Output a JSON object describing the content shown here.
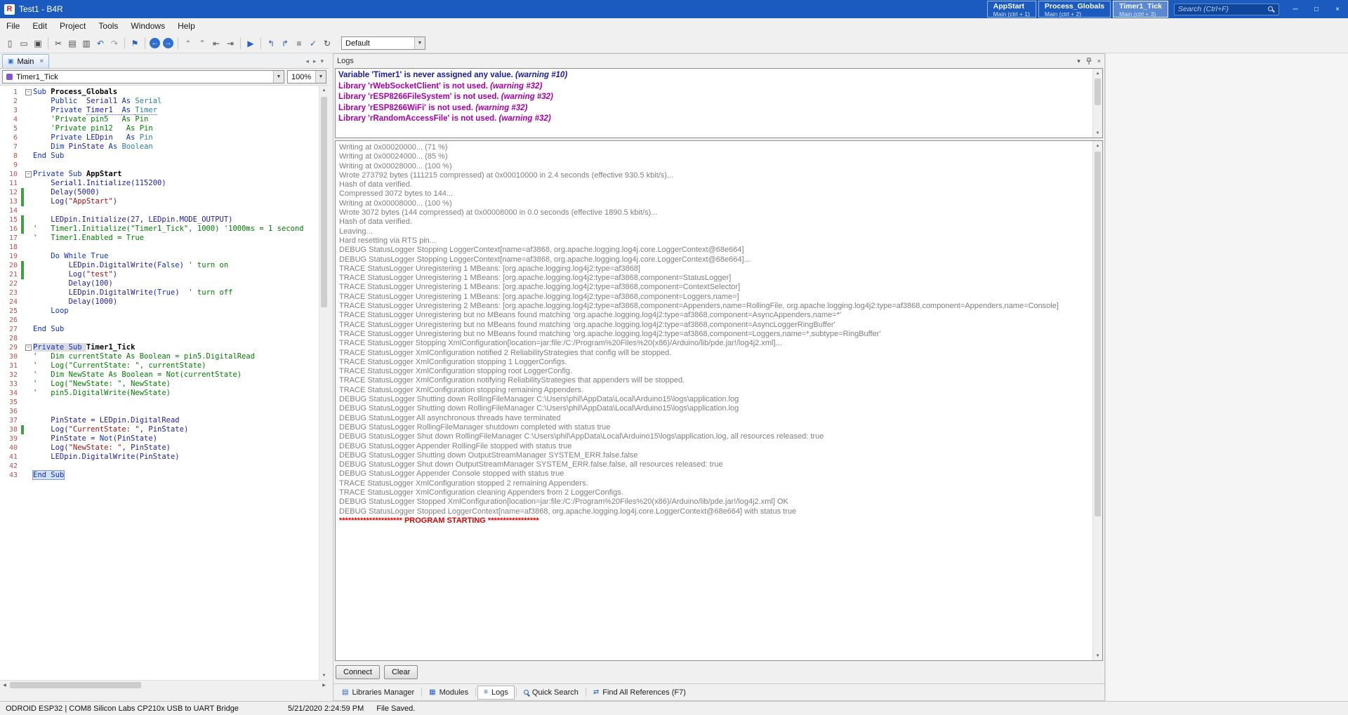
{
  "titlebar": {
    "title": "Test1 - B4R",
    "quick_buttons": [
      {
        "label": "AppStart",
        "sub": "Main (ctrl + 1)"
      },
      {
        "label": "Process_Globals",
        "sub": "Main (ctrl + 2)"
      },
      {
        "label": "Timer1_Tick",
        "sub": "Main (ctrl + 3)"
      }
    ],
    "active_quick_button": 2,
    "search_placeholder": "Search (Ctrl+F)"
  },
  "menubar": {
    "items": [
      "File",
      "Edit",
      "Project",
      "Tools",
      "Windows",
      "Help"
    ]
  },
  "toolbar": {
    "build_config": "Default",
    "icons": [
      {
        "kind": "icon",
        "name": "new-file-icon",
        "glyph": "▯"
      },
      {
        "kind": "icon",
        "name": "open-project-icon",
        "glyph": "▭"
      },
      {
        "kind": "icon",
        "name": "save-icon",
        "glyph": "▣"
      },
      {
        "kind": "sep"
      },
      {
        "kind": "icon",
        "name": "cut-icon",
        "glyph": "✂"
      },
      {
        "kind": "icon",
        "name": "copy-icon",
        "glyph": "▤"
      },
      {
        "kind": "icon",
        "name": "paste-icon",
        "glyph": "▥"
      },
      {
        "kind": "icon",
        "name": "undo-icon",
        "glyph": "↶",
        "color": "#2a62c4"
      },
      {
        "kind": "icon",
        "name": "redo-icon",
        "glyph": "↷",
        "color": "#9a9a9a"
      },
      {
        "kind": "sep"
      },
      {
        "kind": "icon",
        "name": "bookmark-icon",
        "glyph": "⚑",
        "color": "#2a62c4"
      },
      {
        "kind": "sep"
      },
      {
        "kind": "circle",
        "name": "navigate-back-icon",
        "glyph": "←"
      },
      {
        "kind": "circle",
        "name": "navigate-forward-icon",
        "glyph": "→"
      },
      {
        "kind": "sep"
      },
      {
        "kind": "icon",
        "name": "comment-icon",
        "glyph": "“"
      },
      {
        "kind": "icon",
        "name": "uncomment-icon",
        "glyph": "”"
      },
      {
        "kind": "icon",
        "name": "outdent-icon",
        "glyph": "⇤"
      },
      {
        "kind": "icon",
        "name": "indent-icon",
        "glyph": "⇥"
      },
      {
        "kind": "sep"
      },
      {
        "kind": "icon",
        "name": "run-icon",
        "glyph": "▶",
        "color": "#2a62c4"
      },
      {
        "kind": "sep"
      },
      {
        "kind": "icon",
        "name": "goto-previous-sub-icon",
        "glyph": "↰",
        "color": "#2a62c4"
      },
      {
        "kind": "icon",
        "name": "goto-next-sub-icon",
        "glyph": "↱",
        "color": "#2a62c4"
      },
      {
        "kind": "icon",
        "name": "menu-icon",
        "glyph": "≡"
      },
      {
        "kind": "icon",
        "name": "compile-check-icon",
        "glyph": "✓",
        "color": "#2a62c4"
      },
      {
        "kind": "icon",
        "name": "refresh-icon",
        "glyph": "↻"
      }
    ]
  },
  "editor": {
    "tab_label": "Main",
    "member_dropdown": "Timer1_Tick",
    "zoom": "100%",
    "lines": [
      {
        "n": 1,
        "fold": true,
        "tokens": [
          [
            "k",
            "Sub "
          ],
          [
            "b",
            "Process_Globals"
          ]
        ]
      },
      {
        "n": 2,
        "tokens": [
          [
            "d",
            "    "
          ],
          [
            "k",
            "Public  "
          ],
          [
            "d",
            "Serial1 "
          ],
          [
            "k",
            "As "
          ],
          [
            "t",
            "Serial"
          ]
        ]
      },
      {
        "n": 3,
        "tokens": [
          [
            "d",
            "    "
          ],
          [
            "k",
            "Private "
          ],
          [
            "d sq",
            "Timer1  "
          ],
          [
            "k sq",
            "As "
          ],
          [
            "t sq",
            "Timer"
          ]
        ]
      },
      {
        "n": 4,
        "tokens": [
          [
            "d",
            "    "
          ],
          [
            "c",
            "'Private pin5   As Pin"
          ]
        ]
      },
      {
        "n": 5,
        "tokens": [
          [
            "d",
            "    "
          ],
          [
            "c",
            "'Private pin12   As Pin"
          ]
        ]
      },
      {
        "n": 6,
        "tokens": [
          [
            "d",
            "    "
          ],
          [
            "k",
            "Private "
          ],
          [
            "d",
            "LEDpin   "
          ],
          [
            "k",
            "As "
          ],
          [
            "t",
            "Pin"
          ]
        ]
      },
      {
        "n": 7,
        "tokens": [
          [
            "d",
            "    "
          ],
          [
            "k",
            "Dim "
          ],
          [
            "d",
            "PinState "
          ],
          [
            "k",
            "As "
          ],
          [
            "t",
            "Boolean"
          ]
        ]
      },
      {
        "n": 8,
        "tokens": [
          [
            "k",
            "End Sub"
          ]
        ]
      },
      {
        "n": 9,
        "tokens": []
      },
      {
        "n": 10,
        "fold": true,
        "tokens": [
          [
            "k",
            "Private Sub "
          ],
          [
            "b",
            "AppStart"
          ]
        ]
      },
      {
        "n": 11,
        "tokens": [
          [
            "d",
            "    Serial1.Initialize("
          ],
          [
            "n",
            "115200"
          ],
          [
            "d",
            ")"
          ]
        ]
      },
      {
        "n": 12,
        "chg": true,
        "tokens": [
          [
            "d",
            "    Delay("
          ],
          [
            "n",
            "5000"
          ],
          [
            "d",
            ")"
          ]
        ]
      },
      {
        "n": 13,
        "chg": true,
        "tokens": [
          [
            "d",
            "    Log("
          ],
          [
            "s",
            "\"AppStart\""
          ],
          [
            "d",
            ")"
          ]
        ]
      },
      {
        "n": 14,
        "tokens": []
      },
      {
        "n": 15,
        "chg": true,
        "tokens": [
          [
            "d",
            "    LEDpin.Initialize("
          ],
          [
            "n",
            "27"
          ],
          [
            "d",
            ", LEDpin.MODE_OUTPUT)"
          ]
        ]
      },
      {
        "n": 16,
        "chg": true,
        "tokens": [
          [
            "c",
            "'   Timer1.Initialize(\"Timer1_Tick\", 1000) '1000ms = 1 second"
          ]
        ]
      },
      {
        "n": 17,
        "tokens": [
          [
            "c",
            "'   Timer1.Enabled = True"
          ]
        ]
      },
      {
        "n": 18,
        "tokens": []
      },
      {
        "n": 19,
        "tokens": [
          [
            "d",
            "    "
          ],
          [
            "k",
            "Do While True"
          ]
        ]
      },
      {
        "n": 20,
        "chg": true,
        "tokens": [
          [
            "d",
            "        LEDpin.DigitalWrite("
          ],
          [
            "k",
            "False"
          ],
          [
            "d",
            ") "
          ],
          [
            "c",
            "' turn on"
          ]
        ]
      },
      {
        "n": 21,
        "chg": true,
        "tokens": [
          [
            "d",
            "        Log("
          ],
          [
            "s",
            "\"test\""
          ],
          [
            "d",
            ")"
          ]
        ]
      },
      {
        "n": 22,
        "tokens": [
          [
            "d",
            "        Delay("
          ],
          [
            "n",
            "100"
          ],
          [
            "d",
            ")"
          ]
        ]
      },
      {
        "n": 23,
        "tokens": [
          [
            "d",
            "        LEDpin.DigitalWrite("
          ],
          [
            "k",
            "True"
          ],
          [
            "d",
            ")  "
          ],
          [
            "c",
            "' turn off"
          ]
        ]
      },
      {
        "n": 24,
        "tokens": [
          [
            "d",
            "        Delay("
          ],
          [
            "n",
            "1000"
          ],
          [
            "d",
            ")"
          ]
        ]
      },
      {
        "n": 25,
        "tokens": [
          [
            "d",
            "    "
          ],
          [
            "k",
            "Loop"
          ]
        ]
      },
      {
        "n": 26,
        "tokens": []
      },
      {
        "n": 27,
        "tokens": [
          [
            "k",
            "End Sub"
          ]
        ]
      },
      {
        "n": 28,
        "tokens": []
      },
      {
        "n": 29,
        "fold": true,
        "tokens": [
          [
            "k hl",
            "Private Sub "
          ],
          [
            "b",
            "Timer1_Tick"
          ]
        ]
      },
      {
        "n": 30,
        "tokens": [
          [
            "c",
            "'   Dim currentState As Boolean = pin5.DigitalRead"
          ]
        ]
      },
      {
        "n": 31,
        "tokens": [
          [
            "c",
            "'   Log(\"CurrentState: \", currentState)"
          ]
        ]
      },
      {
        "n": 32,
        "tokens": [
          [
            "c",
            "'   Dim NewState As Boolean = Not(currentState)"
          ]
        ]
      },
      {
        "n": 33,
        "tokens": [
          [
            "c",
            "'   Log(\"NewState: \", NewState)"
          ]
        ]
      },
      {
        "n": 34,
        "tokens": [
          [
            "c",
            "'   pin5.DigitalWrite(NewState)"
          ]
        ]
      },
      {
        "n": 35,
        "tokens": []
      },
      {
        "n": 36,
        "tokens": []
      },
      {
        "n": 37,
        "tokens": [
          [
            "d",
            "    PinState = LEDpin.DigitalRead"
          ]
        ]
      },
      {
        "n": 38,
        "chg": true,
        "tokens": [
          [
            "d",
            "    Log("
          ],
          [
            "s",
            "\"CurrentState: \""
          ],
          [
            "d",
            ", PinState)"
          ]
        ]
      },
      {
        "n": 39,
        "tokens": [
          [
            "d",
            "    PinState = "
          ],
          [
            "k",
            "Not"
          ],
          [
            "d",
            "(PinState)"
          ]
        ]
      },
      {
        "n": 40,
        "tokens": [
          [
            "d",
            "    Log("
          ],
          [
            "s",
            "\"NewState: \""
          ],
          [
            "d",
            ", PinState)"
          ]
        ]
      },
      {
        "n": 41,
        "tokens": [
          [
            "d",
            "    LEDpin.DigitalWrite(PinState)"
          ]
        ]
      },
      {
        "n": 42,
        "tokens": []
      },
      {
        "n": 43,
        "caret": true,
        "tokens": [
          [
            "k sel",
            "End Sub"
          ]
        ]
      }
    ]
  },
  "logs_panel": {
    "title": "Logs",
    "warnings": [
      {
        "text": "Variable 'Timer1' is never assigned any value.",
        "tag": "(warning #10)",
        "color": "#1a1a9c"
      },
      {
        "text": "Library 'rWebSocketClient' is not used.",
        "tag": "(warning #32)",
        "color": "#a800a8"
      },
      {
        "text": "Library 'rESP8266FileSystem' is not used.",
        "tag": "(warning #32)",
        "color": "#a800a8"
      },
      {
        "text": "Library 'rESP8266WiFi' is not used.",
        "tag": "(warning #32)",
        "color": "#a800a8"
      },
      {
        "text": "Library 'rRandomAccessFile' is not used.",
        "tag": "(warning #32)",
        "color": "#a800a8"
      }
    ],
    "output": [
      "Writing at 0x00020000... (71 %)",
      "Writing at 0x00024000... (85 %)",
      "Writing at 0x00028000... (100 %)",
      "Wrote 273792 bytes (111215 compressed) at 0x00010000 in 2.4 seconds (effective 930.5 kbit/s)...",
      "Hash of data verified.",
      "Compressed 3072 bytes to 144...",
      "Writing at 0x00008000... (100 %)",
      "Wrote 3072 bytes (144 compressed) at 0x00008000 in 0.0 seconds (effective 1890.5 kbit/s)...",
      "Hash of data verified.",
      "Leaving...",
      "Hard resetting via RTS pin...",
      "DEBUG StatusLogger Stopping LoggerContext[name=af3868, org.apache.logging.log4j.core.LoggerContext@68e664]",
      "DEBUG StatusLogger Stopping LoggerContext[name=af3868, org.apache.logging.log4j.core.LoggerContext@68e664]...",
      "TRACE StatusLogger Unregistering 1 MBeans: [org.apache.logging.log4j2:type=af3868]",
      "TRACE StatusLogger Unregistering 1 MBeans: [org.apache.logging.log4j2:type=af3868,component=StatusLogger]",
      "TRACE StatusLogger Unregistering 1 MBeans: [org.apache.logging.log4j2:type=af3868,component=ContextSelector]",
      "TRACE StatusLogger Unregistering 1 MBeans: [org.apache.logging.log4j2:type=af3868,component=Loggers,name=]",
      "TRACE StatusLogger Unregistering 2 MBeans: [org.apache.logging.log4j2:type=af3868,component=Appenders,name=RollingFile, org.apache.logging.log4j2:type=af3868,component=Appenders,name=Console]",
      "TRACE StatusLogger Unregistering but no MBeans found matching 'org.apache.logging.log4j2:type=af3868,component=AsyncAppenders,name=*'",
      "TRACE StatusLogger Unregistering but no MBeans found matching 'org.apache.logging.log4j2:type=af3868,component=AsyncLoggerRingBuffer'",
      "TRACE StatusLogger Unregistering but no MBeans found matching 'org.apache.logging.log4j2:type=af3868,component=Loggers,name=*,subtype=RingBuffer'",
      "TRACE StatusLogger Stopping XmlConfiguration[location=jar:file:/C:/Program%20Files%20(x86)/Arduino/lib/pde.jar!/log4j2.xml]...",
      "TRACE StatusLogger XmlConfiguration notified 2 ReliabilityStrategies that config will be stopped.",
      "TRACE StatusLogger XmlConfiguration stopping 1 LoggerConfigs.",
      "TRACE StatusLogger XmlConfiguration stopping root LoggerConfig.",
      "TRACE StatusLogger XmlConfiguration notifying ReliabilityStrategies that appenders will be stopped.",
      "TRACE StatusLogger XmlConfiguration stopping remaining Appenders.",
      "DEBUG StatusLogger Shutting down RollingFileManager C:\\Users\\phil\\AppData\\Local\\Arduino15\\logs\\application.log",
      "DEBUG StatusLogger Shutting down RollingFileManager C:\\Users\\phil\\AppData\\Local\\Arduino15\\logs\\application.log",
      "DEBUG StatusLogger All asynchronous threads have terminated",
      "DEBUG StatusLogger RollingFileManager shutdown completed with status true",
      "DEBUG StatusLogger Shut down RollingFileManager C:\\Users\\phil\\AppData\\Local\\Arduino15\\logs\\application.log, all resources released: true",
      "DEBUG StatusLogger Appender RollingFile stopped with status true",
      "DEBUG StatusLogger Shutting down OutputStreamManager SYSTEM_ERR.false.false",
      "DEBUG StatusLogger Shut down OutputStreamManager SYSTEM_ERR.false.false, all resources released: true",
      "DEBUG StatusLogger Appender Console stopped with status true",
      "TRACE StatusLogger XmlConfiguration stopped 2 remaining Appenders.",
      "TRACE StatusLogger XmlConfiguration cleaning Appenders from 2 LoggerConfigs.",
      "DEBUG StatusLogger Stopped XmlConfiguration[location=jar:file:/C:/Program%20Files%20(x86)/Arduino/lib/pde.jar!/log4j2.xml] OK",
      "DEBUG StatusLogger Stopped LoggerContext[name=af3868, org.apache.logging.log4j.core.LoggerContext@68e664] with status true"
    ],
    "final_line": "********************* PROGRAM STARTING *****************",
    "buttons": [
      "Connect",
      "Clear"
    ],
    "tabs": [
      {
        "label": "Libraries Manager",
        "icon": "libraries-manager-icon",
        "glyph": "▤"
      },
      {
        "label": "Modules",
        "icon": "modules-icon",
        "glyph": "▦"
      },
      {
        "label": "Logs",
        "icon": "logs-icon",
        "glyph": "≡"
      },
      {
        "label": "Quick Search",
        "icon": "magnifier-icon",
        "glyph": "mag"
      },
      {
        "label": "Find All References (F7)",
        "icon": "references-icon",
        "glyph": "⇄"
      }
    ],
    "active_tab": 2
  },
  "statusbar": {
    "board": "ODROID ESP32 | COM8 Silicon Labs CP210x USB to UART Bridge",
    "datetime": "5/21/2020 2:24:59 PM",
    "file_status": "File Saved."
  }
}
